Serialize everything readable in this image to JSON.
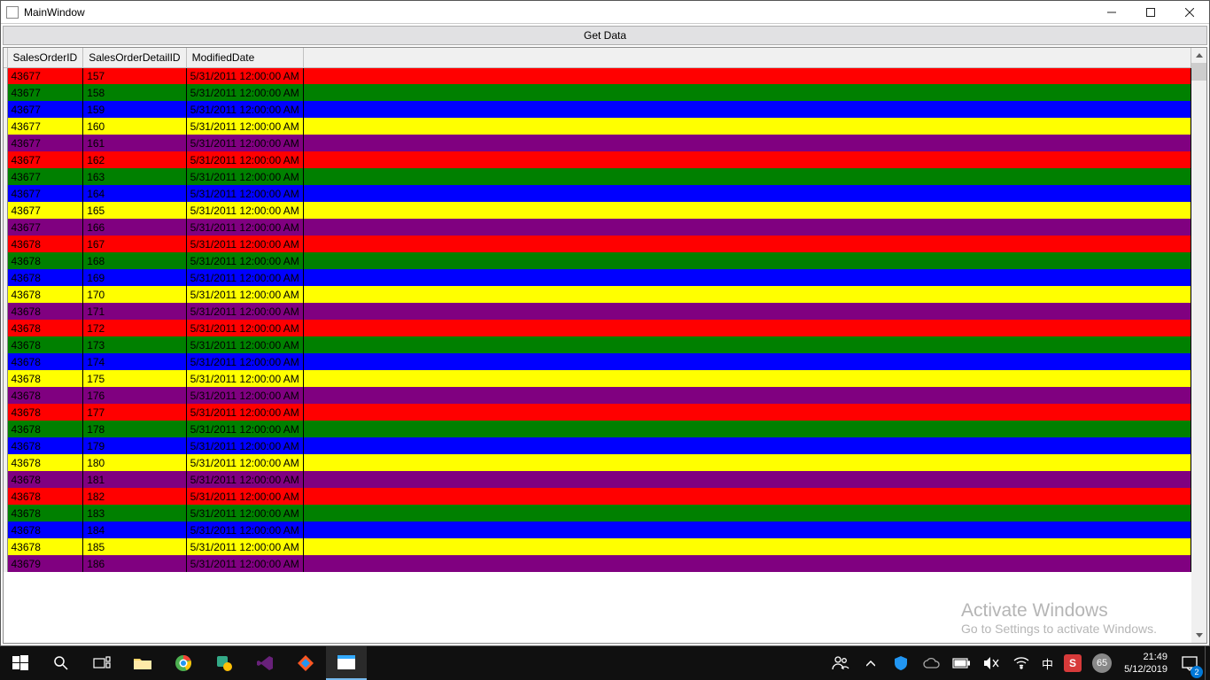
{
  "window": {
    "title": "MainWindow"
  },
  "button": {
    "get_data_label": "Get Data"
  },
  "grid": {
    "columns": [
      "SalesOrderID",
      "SalesOrderDetailID",
      "ModifiedDate"
    ],
    "rows": [
      {
        "c": "red",
        "v": [
          "43677",
          "157",
          "5/31/2011 12:00:00 AM"
        ]
      },
      {
        "c": "green",
        "v": [
          "43677",
          "158",
          "5/31/2011 12:00:00 AM"
        ]
      },
      {
        "c": "blue",
        "v": [
          "43677",
          "159",
          "5/31/2011 12:00:00 AM"
        ]
      },
      {
        "c": "yellow",
        "v": [
          "43677",
          "160",
          "5/31/2011 12:00:00 AM"
        ]
      },
      {
        "c": "purple",
        "v": [
          "43677",
          "161",
          "5/31/2011 12:00:00 AM"
        ]
      },
      {
        "c": "red",
        "v": [
          "43677",
          "162",
          "5/31/2011 12:00:00 AM"
        ]
      },
      {
        "c": "green",
        "v": [
          "43677",
          "163",
          "5/31/2011 12:00:00 AM"
        ]
      },
      {
        "c": "blue",
        "v": [
          "43677",
          "164",
          "5/31/2011 12:00:00 AM"
        ]
      },
      {
        "c": "yellow",
        "v": [
          "43677",
          "165",
          "5/31/2011 12:00:00 AM"
        ]
      },
      {
        "c": "purple",
        "v": [
          "43677",
          "166",
          "5/31/2011 12:00:00 AM"
        ]
      },
      {
        "c": "red",
        "v": [
          "43678",
          "167",
          "5/31/2011 12:00:00 AM"
        ]
      },
      {
        "c": "green",
        "v": [
          "43678",
          "168",
          "5/31/2011 12:00:00 AM"
        ]
      },
      {
        "c": "blue",
        "v": [
          "43678",
          "169",
          "5/31/2011 12:00:00 AM"
        ]
      },
      {
        "c": "yellow",
        "v": [
          "43678",
          "170",
          "5/31/2011 12:00:00 AM"
        ]
      },
      {
        "c": "purple",
        "v": [
          "43678",
          "171",
          "5/31/2011 12:00:00 AM"
        ]
      },
      {
        "c": "red",
        "v": [
          "43678",
          "172",
          "5/31/2011 12:00:00 AM"
        ]
      },
      {
        "c": "green",
        "v": [
          "43678",
          "173",
          "5/31/2011 12:00:00 AM"
        ]
      },
      {
        "c": "blue",
        "v": [
          "43678",
          "174",
          "5/31/2011 12:00:00 AM"
        ]
      },
      {
        "c": "yellow",
        "v": [
          "43678",
          "175",
          "5/31/2011 12:00:00 AM"
        ]
      },
      {
        "c": "purple",
        "v": [
          "43678",
          "176",
          "5/31/2011 12:00:00 AM"
        ]
      },
      {
        "c": "red",
        "v": [
          "43678",
          "177",
          "5/31/2011 12:00:00 AM"
        ]
      },
      {
        "c": "green",
        "v": [
          "43678",
          "178",
          "5/31/2011 12:00:00 AM"
        ]
      },
      {
        "c": "blue",
        "v": [
          "43678",
          "179",
          "5/31/2011 12:00:00 AM"
        ]
      },
      {
        "c": "yellow",
        "v": [
          "43678",
          "180",
          "5/31/2011 12:00:00 AM"
        ]
      },
      {
        "c": "purple",
        "v": [
          "43678",
          "181",
          "5/31/2011 12:00:00 AM"
        ]
      },
      {
        "c": "red",
        "v": [
          "43678",
          "182",
          "5/31/2011 12:00:00 AM"
        ]
      },
      {
        "c": "green",
        "v": [
          "43678",
          "183",
          "5/31/2011 12:00:00 AM"
        ]
      },
      {
        "c": "blue",
        "v": [
          "43678",
          "184",
          "5/31/2011 12:00:00 AM"
        ]
      },
      {
        "c": "yellow",
        "v": [
          "43678",
          "185",
          "5/31/2011 12:00:00 AM"
        ]
      },
      {
        "c": "purple",
        "v": [
          "43679",
          "186",
          "5/31/2011 12:00:00 AM"
        ]
      }
    ]
  },
  "watermark": {
    "line1": "Activate Windows",
    "line2": "Go to Settings to activate Windows."
  },
  "taskbar": {
    "time": "21:49",
    "date": "5/12/2019",
    "temp": "65",
    "notif_count": "2",
    "ime": "中"
  }
}
